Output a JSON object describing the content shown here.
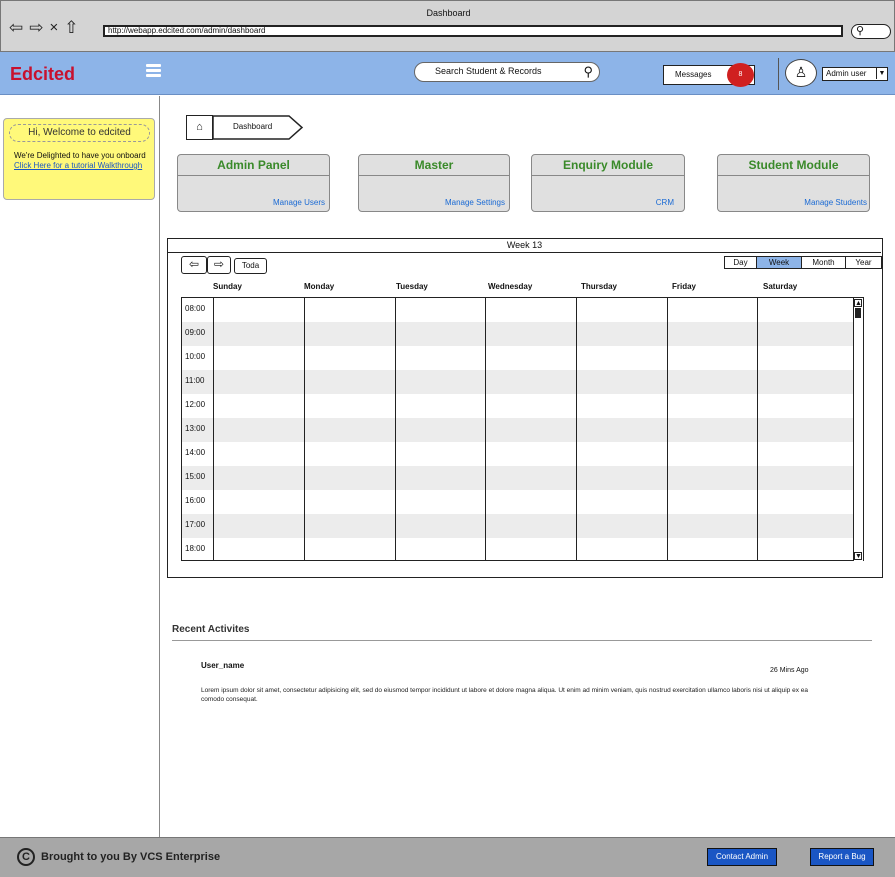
{
  "browser": {
    "title": "Dashboard",
    "url": "http://webapp.edcited.com/admin/dashboard",
    "nav_icons": [
      "back-arrow-icon",
      "forward-arrow-icon",
      "close-icon",
      "home-icon"
    ],
    "back_glyph": "⇦",
    "forward_glyph": "⇨",
    "close_glyph": "×",
    "home_glyph": "⇧",
    "search_glyph": "⚲"
  },
  "header": {
    "brand": "Edcited",
    "search_placeholder": "Search  Student  & Records",
    "search_glyph": "⚲",
    "messages_label": "Messages",
    "messages_count": "8",
    "avatar_glyph": "♙",
    "user_label": "Admin user",
    "dropdown_glyph": "▼"
  },
  "sidebar": {
    "welcome_title": "Hi, Welcome to edcited",
    "welcome_text": "We're Delighted to have you onboard",
    "welcome_link": "Click Here for a tutorial Walkthrough"
  },
  "breadcrumb": {
    "home_glyph": "⌂",
    "current": "Dashboard"
  },
  "modules": [
    {
      "title": "Admin Panel",
      "link": "Manage Users"
    },
    {
      "title": "Master",
      "link": "Manage Settings"
    },
    {
      "title": "Enquiry Module",
      "link": "CRM"
    },
    {
      "title": "Student Module",
      "link": "Manage Students"
    }
  ],
  "calendar": {
    "week_label": "Week 13",
    "prev_glyph": "⇦",
    "next_glyph": "⇨",
    "today_label": "Toda",
    "views": [
      "Day",
      "Week",
      "Month",
      "Year"
    ],
    "active_view": "Week",
    "days": [
      "Sunday",
      "Monday",
      "Tuesday",
      "Wednesday",
      "Thursday",
      "Friday",
      "Saturday"
    ],
    "times": [
      "08:00",
      "09:00",
      "10:00",
      "11:00",
      "12:00",
      "13:00",
      "14:00",
      "15:00",
      "16:00",
      "17:00",
      "18:00"
    ],
    "scroll_up_glyph": "▲",
    "scroll_down_glyph": "▼"
  },
  "recent": {
    "title": "Recent Activites",
    "user": "User_name",
    "time": "26 Mins Ago",
    "body": "Lorem ipsum dolor sit amet, consectetur adipisicing elit, sed do eiusmod tempor incididunt ut labore et dolore magna aliqua. Ut enim ad minim veniam, quis nostrud exercitation ullamco laboris nisi ut aliquip ex ea comodo consequat."
  },
  "footer": {
    "copyright_glyph": "C",
    "text": "Brought to you By VCS Enterprise",
    "contact_label": "Contact Admin",
    "bug_label": "Report a Bug"
  },
  "colors": {
    "brand": "#c8102e",
    "header_bg": "#8db4e8",
    "module_title": "#3a8a2a",
    "link": "#1a6ad4",
    "badge": "#d02020",
    "welcome_bg": "#fff97a",
    "footer_bg": "#a7a7a7"
  }
}
